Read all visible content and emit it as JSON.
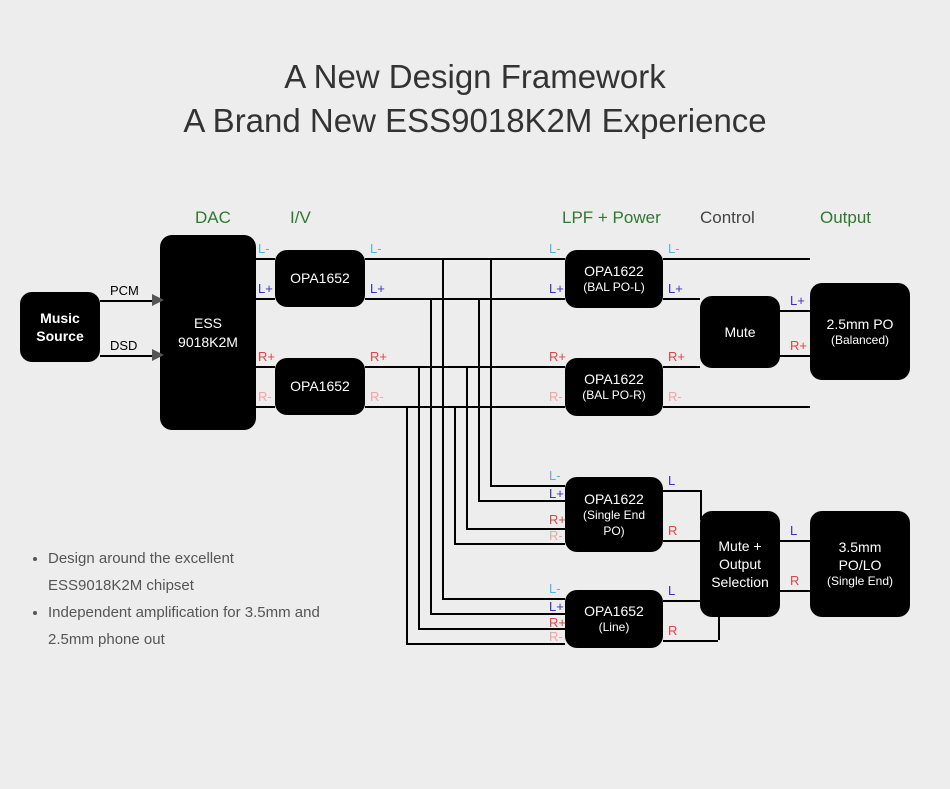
{
  "title": {
    "line1": "A New Design Framework",
    "line2": "A Brand New ESS9018K2M Experience"
  },
  "columns": {
    "dac": "DAC",
    "iv": "I/V",
    "lpf": "LPF + Power",
    "control": "Control",
    "output": "Output"
  },
  "signals": {
    "lm": "L-",
    "lp": "L+",
    "rp": "R+",
    "rm": "R-",
    "l": "L",
    "r": "R",
    "pcm": "PCM",
    "dsd": "DSD"
  },
  "boxes": {
    "source": "Music Source",
    "dac": "ESS 9018K2M",
    "iv_top": "OPA1652",
    "iv_bot": "OPA1652",
    "lpf_pol": "OPA1622",
    "lpf_pol_sub": "(BAL PO-L)",
    "lpf_por": "OPA1622",
    "lpf_por_sub": "(BAL PO-R)",
    "lpf_se": "OPA1622",
    "lpf_se_sub": "(Single End PO)",
    "lpf_line": "OPA1652",
    "lpf_line_sub": "(Line)",
    "mute": "Mute",
    "mute_sel": "Mute + Output Selection",
    "out25": "2.5mm PO",
    "out25_sub": "(Balanced)",
    "out35": "3.5mm PO/LO",
    "out35_sub": "(Single End)"
  },
  "bullets": [
    "Design around the excellent ESS9018K2M chipset",
    "Independent amplification for 3.5mm and 2.5mm phone out"
  ]
}
